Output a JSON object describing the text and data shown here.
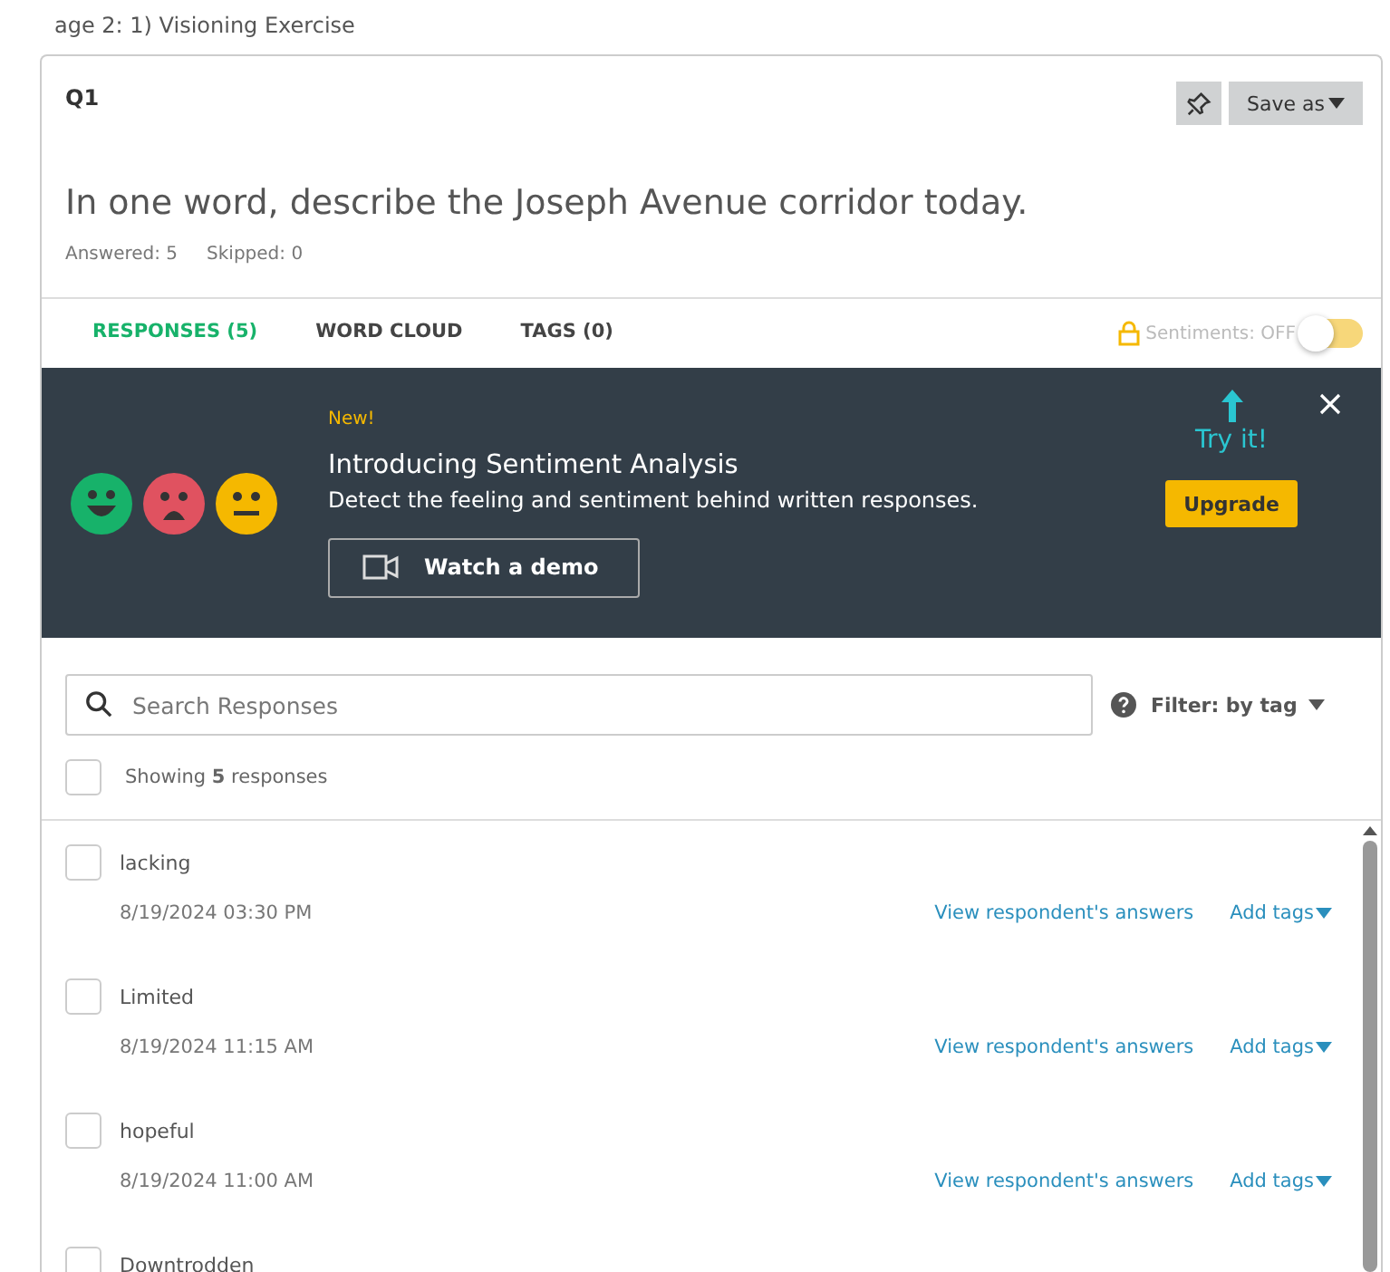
{
  "breadcrumb": "age 2: 1) Visioning Exercise",
  "question": {
    "number": "Q1",
    "text": "In one word, describe the Joseph Avenue corridor today.",
    "answered": "Answered: 5",
    "skipped": "Skipped: 0",
    "save_label": "Save as"
  },
  "tabs": [
    {
      "label": "RESPONSES (5)",
      "selected": true
    },
    {
      "label": "WORD CLOUD",
      "selected": false
    },
    {
      "label": "TAGS (0)",
      "selected": false
    }
  ],
  "sentiments": {
    "label": "Sentiments: OFF",
    "on": false
  },
  "banner": {
    "badge": "New!",
    "title": "Introducing Sentiment Analysis",
    "description": "Detect the feeling and sentiment behind written responses.",
    "demo_button": "Watch a demo",
    "try_label": "Try it!",
    "upgrade_button": "Upgrade"
  },
  "search": {
    "placeholder": "Search Responses"
  },
  "filter": "Filter: by tag",
  "showing": {
    "text": "Showing **5** responses",
    "checked": false
  },
  "responses": [
    {
      "text": "lacking",
      "date": "8/19/2024 03:30 PM",
      "checked": false,
      "view_link": "View respondent's answers",
      "tags_link": "Add tags"
    },
    {
      "text": "Limited",
      "date": "8/19/2024 11:15 AM",
      "checked": false,
      "view_link": "View respondent's answers",
      "tags_link": "Add tags"
    },
    {
      "text": "hopeful",
      "date": "8/19/2024 11:00 AM",
      "checked": false,
      "view_link": "View respondent's answers",
      "tags_link": "Add tags"
    },
    {
      "text": "Downtrodden",
      "checked": false
    }
  ]
}
